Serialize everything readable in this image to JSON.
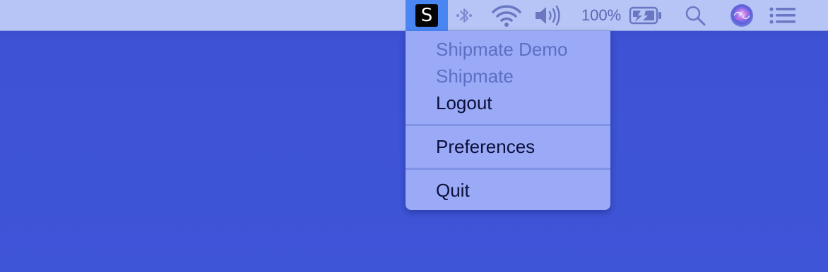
{
  "menubar": {
    "app_icon_letter": "S",
    "battery_percent_text": "100%",
    "icons": [
      "shipmate-app-icon",
      "bluetooth-icon",
      "wifi-icon",
      "volume-icon",
      "battery-charging-icon",
      "spotlight-search-icon",
      "siri-icon",
      "notification-center-icon"
    ]
  },
  "menu": {
    "items": [
      {
        "label": "Shipmate Demo",
        "enabled": false
      },
      {
        "label": "Shipmate",
        "enabled": false
      },
      {
        "label": "Logout",
        "enabled": true
      },
      {
        "label": "Preferences",
        "enabled": true
      },
      {
        "label": "Quit",
        "enabled": true
      }
    ]
  },
  "colors": {
    "desktop": "#3f55d8",
    "menubar": "#b6c4f6",
    "menu_background": "#9aaaf6",
    "app_item_highlight": "#4a86f2",
    "disabled_text": "#5d6ec4",
    "enabled_text": "#0c0f3a"
  }
}
